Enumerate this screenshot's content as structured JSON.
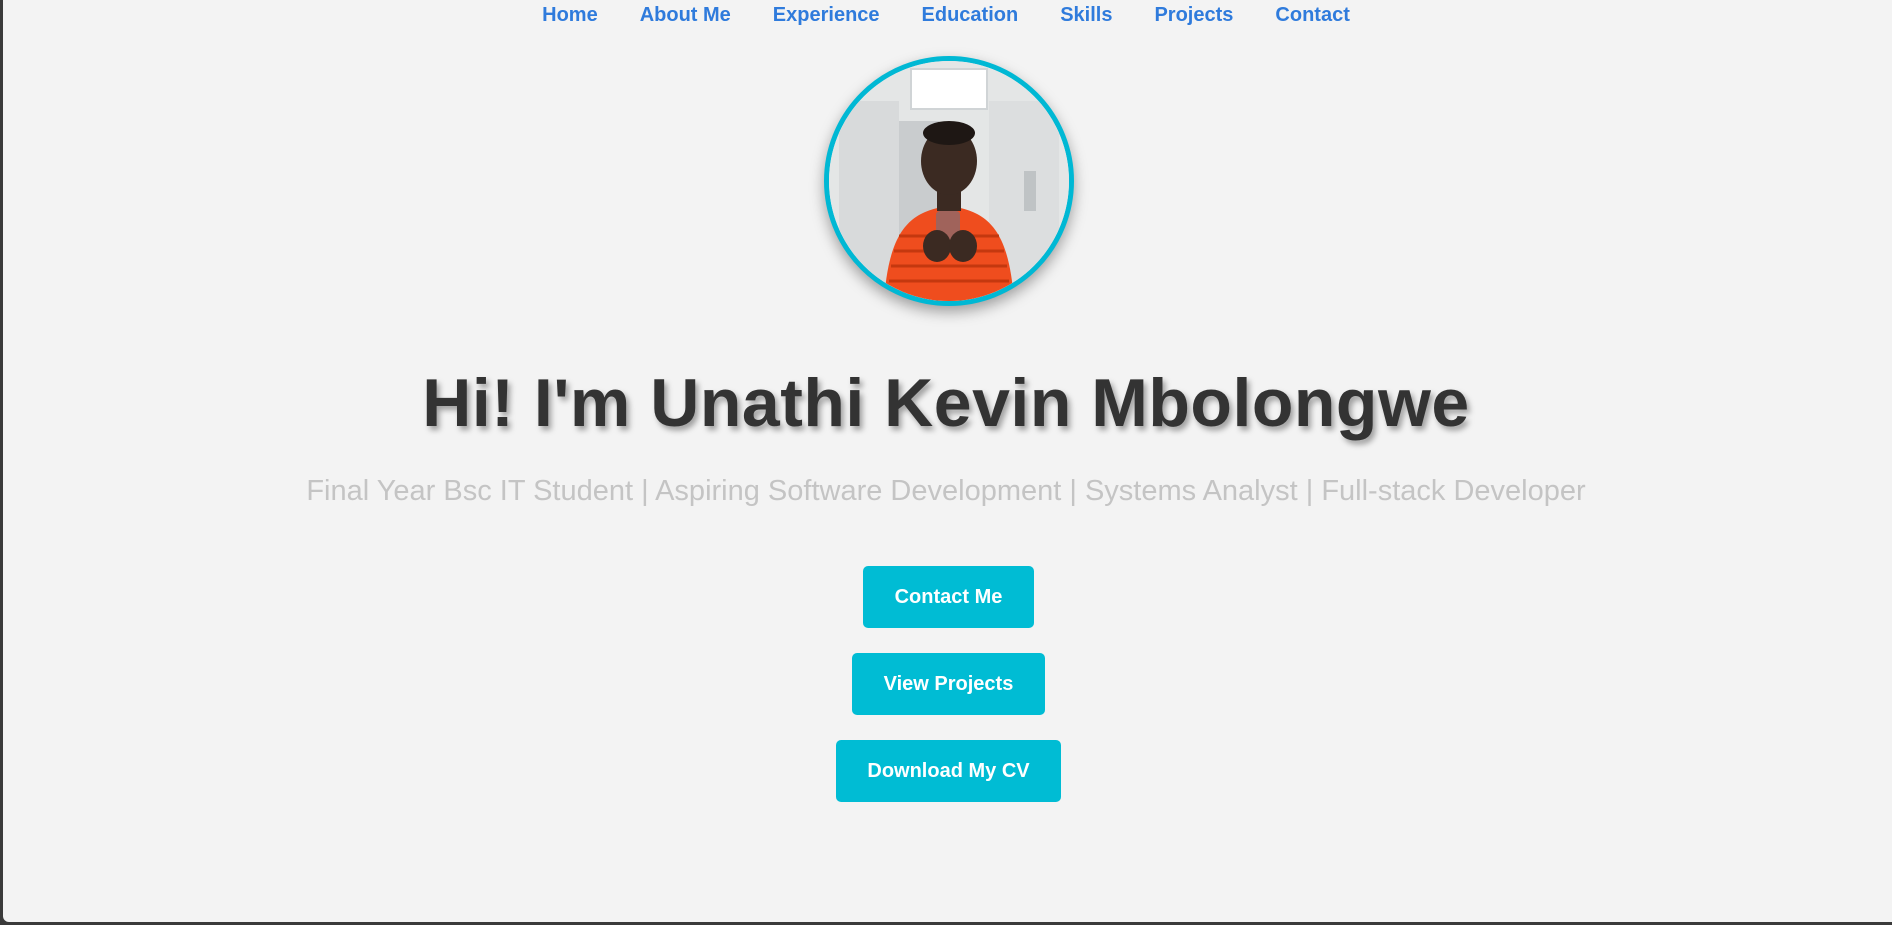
{
  "nav": {
    "items": [
      {
        "label": "Home"
      },
      {
        "label": "About Me"
      },
      {
        "label": "Experience"
      },
      {
        "label": "Education"
      },
      {
        "label": "Skills"
      },
      {
        "label": "Projects"
      },
      {
        "label": "Contact"
      }
    ]
  },
  "hero": {
    "avatar_icon": "profile-photo",
    "title": "Hi! I'm Unathi Kevin Mbolongwe",
    "subtitle": "Final Year Bsc IT Student | Aspiring Software Development | Systems Analyst | Full-stack Developer"
  },
  "buttons": {
    "contact": "Contact Me",
    "projects": "View Projects",
    "cv": "Download My CV"
  },
  "colors": {
    "accent": "#00bcd4",
    "nav_link": "#2f7bdc",
    "title": "#333333",
    "subtitle": "#c4c4c4",
    "background": "#f3f3f3"
  }
}
